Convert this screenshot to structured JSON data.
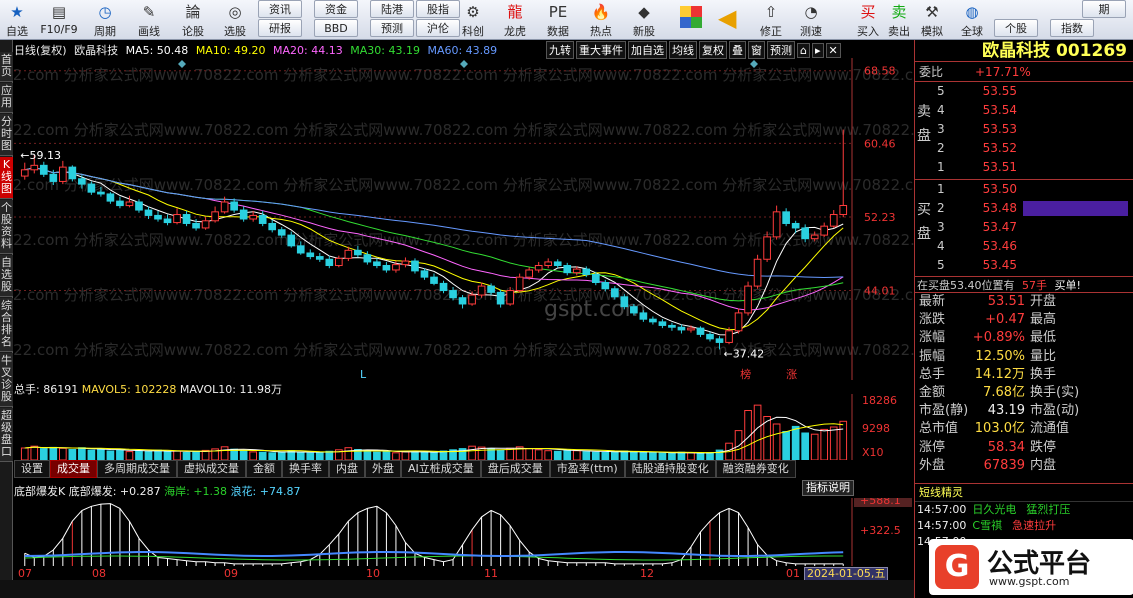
{
  "toolbar": {
    "buttons": [
      {
        "label": "自选",
        "icon": "star-icon"
      },
      {
        "label": "F10/F9",
        "icon": "document-icon"
      },
      {
        "label": "周期",
        "icon": "clock-icon"
      },
      {
        "label": "画线",
        "icon": "pencil-icon"
      },
      {
        "label": "论股",
        "icon": "discuss-icon"
      },
      {
        "label": "选股",
        "icon": "chart-search-icon"
      },
      {
        "label": "科创",
        "icon": "tech-icon"
      },
      {
        "label": "龙虎",
        "icon": "dragon-icon"
      },
      {
        "label": "数据",
        "icon": "pe-data-icon"
      },
      {
        "label": "热点",
        "icon": "hot-icon"
      },
      {
        "label": "新股",
        "icon": "ipo-icon"
      },
      {
        "label": "修正",
        "icon": "arrow-up-icon"
      },
      {
        "label": "测速",
        "icon": "speedometer-icon"
      },
      {
        "label": "买入",
        "icon": "buy-icon"
      },
      {
        "label": "卖出",
        "icon": "sell-icon"
      },
      {
        "label": "模拟",
        "icon": "hammer-icon"
      },
      {
        "label": "全球",
        "icon": "globe-icon"
      }
    ],
    "small_buttons_top": [
      "资讯",
      "资金",
      "陆港",
      "股指",
      "期"
    ],
    "small_buttons_bottom": [
      "研报",
      "BBD",
      "预测",
      "沪伦",
      "个股",
      "指数"
    ],
    "brand_stamps": [
      "PE",
      "HOT"
    ]
  },
  "left_tabs": [
    "首页",
    "应用",
    "分时图",
    "K线图",
    "个股资料",
    "自选股",
    "综合排名",
    "牛叉诊股",
    "超级盘口"
  ],
  "chart_header": {
    "mode": "日线(复权)",
    "stock": "欧晶科技",
    "ma5": "MA5: 50.48",
    "ma10": "MA10: 49.20",
    "ma20": "MA20: 44.13",
    "ma30": "MA30: 43.19",
    "ma60": "MA60: 43.89",
    "buttons": [
      "九转",
      "重大事件",
      "加自选",
      "均线",
      "复权",
      "叠",
      "窗",
      "预测"
    ]
  },
  "watermark": "0822.com 分析家公式网www.70822.com 分析家公式网www.70822.com 分析家公式网www.70822.com 分析家公式网www.70822.com 分析家公式网www.7",
  "watermark_site": "gspt.com",
  "chart_data": [
    {
      "type": "candlestick",
      "title": "欧晶科技 日线(复权)",
      "y_axis_ticks": [
        "68.58",
        "60.46",
        "52.23",
        "44.01"
      ],
      "ylim": [
        34,
        70
      ],
      "annotations": [
        "59.13",
        "37.42",
        "榜",
        "涨",
        "L"
      ],
      "x_month_labels": [
        "07",
        "08",
        "09",
        "10",
        "11",
        "12",
        "01"
      ],
      "closes": [
        57.5,
        58.0,
        57.0,
        56.2,
        57.8,
        56.5,
        55.9,
        55.0,
        54.8,
        54.0,
        53.5,
        53.9,
        53.0,
        52.4,
        52.0,
        51.6,
        52.5,
        51.5,
        51.0,
        51.8,
        52.8,
        53.9,
        53.0,
        52.0,
        52.4,
        51.5,
        50.8,
        50.2,
        49.0,
        48.2,
        47.8,
        47.5,
        46.8,
        47.6,
        48.5,
        48.0,
        47.2,
        46.8,
        46.3,
        46.9,
        47.3,
        46.2,
        45.5,
        44.8,
        44.0,
        43.2,
        42.5,
        43.5,
        44.5,
        43.8,
        42.5,
        44.0,
        45.5,
        46.3,
        46.8,
        47.2,
        46.8,
        46.0,
        46.4,
        45.8,
        44.9,
        44.2,
        43.3,
        42.2,
        41.5,
        40.8,
        40.5,
        40.1,
        39.9,
        39.6,
        39.8,
        39.1,
        38.6,
        38.2,
        39.5,
        41.5,
        44.5,
        47.5,
        50.0,
        52.8,
        51.5,
        51.0,
        49.8,
        50.2,
        51.2,
        52.5,
        53.51
      ],
      "opens": [
        56.8,
        57.5,
        58.0,
        57.0,
        56.2,
        57.8,
        56.5,
        55.9,
        55.0,
        54.8,
        54.0,
        53.5,
        53.9,
        53.0,
        52.4,
        52.0,
        51.6,
        52.5,
        51.5,
        51.0,
        51.8,
        52.8,
        53.9,
        53.0,
        52.0,
        52.4,
        51.5,
        50.8,
        50.2,
        49.0,
        48.2,
        47.8,
        47.5,
        46.8,
        47.6,
        48.5,
        48.0,
        47.2,
        46.8,
        46.3,
        46.9,
        47.3,
        46.2,
        45.5,
        44.8,
        44.0,
        43.2,
        42.5,
        43.5,
        44.5,
        43.8,
        42.5,
        44.0,
        45.5,
        46.3,
        46.8,
        47.2,
        46.8,
        46.0,
        46.4,
        45.8,
        44.9,
        44.2,
        43.3,
        42.2,
        41.5,
        40.8,
        40.5,
        40.1,
        39.9,
        39.6,
        39.8,
        39.1,
        38.6,
        38.2,
        39.5,
        41.5,
        44.5,
        47.5,
        50.0,
        52.8,
        51.5,
        51.0,
        49.8,
        50.2,
        51.2,
        52.5
      ],
      "highs": [
        58.3,
        59.13,
        58.4,
        57.5,
        58.5,
        58.0,
        56.9,
        56.2,
        55.6,
        55.0,
        54.5,
        54.6,
        54.2,
        53.4,
        52.9,
        52.5,
        53.2,
        52.9,
        52.0,
        52.2,
        53.4,
        54.5,
        54.3,
        53.4,
        52.9,
        52.9,
        51.9,
        51.1,
        50.6,
        49.5,
        48.6,
        48.2,
        47.9,
        47.9,
        48.9,
        49.0,
        48.4,
        47.6,
        47.2,
        47.3,
        47.7,
        47.6,
        46.5,
        45.9,
        45.1,
        44.4,
        43.5,
        43.9,
        44.9,
        44.8,
        44.1,
        44.4,
        45.9,
        46.6,
        47.2,
        47.6,
        47.5,
        47.1,
        46.7,
        46.7,
        46.1,
        45.2,
        44.5,
        43.6,
        42.5,
        41.8,
        41.1,
        40.8,
        40.4,
        40.2,
        40.1,
        40.0,
        39.4,
        38.9,
        39.9,
        42.0,
        45.0,
        48.0,
        50.6,
        53.5,
        53.2,
        51.8,
        51.4,
        50.6,
        51.6,
        53.0,
        62.0
      ],
      "lows": [
        56.4,
        57.1,
        56.7,
        55.8,
        55.9,
        56.2,
        55.4,
        54.7,
        54.5,
        53.7,
        53.2,
        53.3,
        52.7,
        52.0,
        51.7,
        51.3,
        51.4,
        51.2,
        50.7,
        50.8,
        51.6,
        52.6,
        52.7,
        51.7,
        51.7,
        51.2,
        50.5,
        49.9,
        48.8,
        48.0,
        47.5,
        47.2,
        46.5,
        46.6,
        47.3,
        47.7,
        46.9,
        46.5,
        46.0,
        46.0,
        46.6,
        45.9,
        45.2,
        44.6,
        43.7,
        42.9,
        42.0,
        42.3,
        43.2,
        43.5,
        42.1,
        42.3,
        43.8,
        45.2,
        46.0,
        46.5,
        46.5,
        45.7,
        45.7,
        45.5,
        44.6,
        43.9,
        43.0,
        41.9,
        41.2,
        40.5,
        40.2,
        39.8,
        39.5,
        39.2,
        39.3,
        38.8,
        38.3,
        37.42,
        38.0,
        39.2,
        41.2,
        44.2,
        47.2,
        49.7,
        51.2,
        50.4,
        49.4,
        49.5,
        50.0,
        51.0,
        52.2
      ]
    },
    {
      "type": "bar",
      "title": "总手",
      "y_axis_ticks": [
        "18286",
        "9298",
        "X10"
      ],
      "ylim": [
        0,
        20000
      ],
      "values": [
        4000,
        4600,
        3800,
        4200,
        3900,
        3500,
        4100,
        3300,
        3600,
        3000,
        3400,
        2800,
        3100,
        2900,
        3300,
        2700,
        3000,
        2500,
        2800,
        3200,
        3700,
        4400,
        3600,
        3000,
        2700,
        2600,
        2400,
        2700,
        3100,
        2600,
        2300,
        2500,
        2900,
        3400,
        4100,
        3500,
        3000,
        2600,
        2800,
        2400,
        2700,
        3000,
        2600,
        2500,
        3000,
        3400,
        3800,
        4600,
        4300,
        3700,
        3200,
        3900,
        4400,
        3800,
        3400,
        3100,
        2900,
        3300,
        3100,
        2800,
        2600,
        2500,
        2800,
        3000,
        2700,
        2500,
        2400,
        2300,
        2200,
        2600,
        2400,
        2200,
        2500,
        3300,
        5600,
        9800,
        16500,
        18286,
        14500,
        12000,
        9500,
        11200,
        9000,
        8600,
        10200,
        11000,
        12900
      ]
    },
    {
      "type": "bar",
      "title": "底部爆发K 底部爆发",
      "y_axis_ticks": [
        "+588.1",
        "+322.5"
      ],
      "values": [
        120,
        80,
        90,
        150,
        260,
        420,
        520,
        560,
        580,
        585,
        540,
        420,
        260,
        150,
        80,
        70,
        60,
        50,
        40,
        40,
        30,
        30,
        20,
        20,
        20,
        20,
        20,
        20,
        30,
        40,
        60,
        110,
        200,
        300,
        420,
        500,
        540,
        560,
        500,
        380,
        220,
        120,
        80,
        60,
        40,
        60,
        200,
        340,
        460,
        520,
        480,
        380,
        240,
        130,
        70,
        50,
        40,
        30,
        30,
        30,
        30,
        30,
        20,
        20,
        20,
        20,
        20,
        20,
        30,
        60,
        180,
        320,
        420,
        500,
        540,
        500,
        360,
        200,
        100,
        50,
        30,
        20,
        20,
        20,
        20,
        20,
        20
      ]
    }
  ],
  "volume_header": {
    "total": "总手: 86191",
    "mavol5": "MAVOL5: 102228",
    "mavol10": "MAVOL10: 11.98万"
  },
  "volume_tabs": [
    "设置",
    "成交量",
    "多周期成交量",
    "虚拟成交量",
    "金额",
    "换手率",
    "内盘",
    "外盘",
    "AI立桩成交量",
    "盘后成交量",
    "市盈率(ttm)",
    "陆股通持股变化",
    "融资融券变化"
  ],
  "indicator_header": {
    "name": "底部爆发K 底部爆发:",
    "v1": "+0.287",
    "v2": "海岸: +1.38",
    "v3": "浪花: +74.87"
  },
  "indicator_button": "指标说明",
  "date_badge": "2024-01-05,五",
  "right_panel": {
    "stock_title": "欧晶科技 001269",
    "commission_label": "委比",
    "commission_value": "+17.71%",
    "sell_side_label": "卖盘",
    "buy_side_label": "买盘",
    "sell_levels": [
      {
        "level": "5",
        "price": "53.55"
      },
      {
        "level": "4",
        "price": "53.54"
      },
      {
        "level": "3",
        "price": "53.53"
      },
      {
        "level": "2",
        "price": "53.52"
      },
      {
        "level": "1",
        "price": "53.51"
      }
    ],
    "buy_levels": [
      {
        "level": "1",
        "price": "53.50"
      },
      {
        "level": "2",
        "price": "53.48"
      },
      {
        "level": "3",
        "price": "53.47"
      },
      {
        "level": "4",
        "price": "53.46"
      },
      {
        "level": "5",
        "price": "53.45"
      }
    ],
    "mid_note": "在买盘53.40位置有",
    "mid_note_qty": "57手",
    "mid_note_action": "买单!",
    "quotes": [
      {
        "l1": "最新",
        "v1": "53.51",
        "l2": "开盘"
      },
      {
        "l1": "涨跌",
        "v1": "+0.47",
        "l2": "最高"
      },
      {
        "l1": "涨幅",
        "v1": "+0.89%",
        "l2": "最低"
      },
      {
        "l1": "振幅",
        "v1": "12.50%",
        "l2": "量比"
      },
      {
        "l1": "总手",
        "v1": "14.12万",
        "l2": "换手"
      },
      {
        "l1": "金额",
        "v1": "7.68亿",
        "l2": "换手(实)"
      },
      {
        "l1": "市盈(静)",
        "v1": "43.19",
        "l2": "市盈(动)"
      },
      {
        "l1": "总市值",
        "v1": "103.0亿",
        "l2": "流通值"
      },
      {
        "l1": "涨停",
        "v1": "58.34",
        "l2": "跌停"
      },
      {
        "l1": "外盘",
        "v1": "67839",
        "l2": "内盘"
      }
    ],
    "alerts_title": "短线精灵",
    "alerts": [
      {
        "time": "14:57:00",
        "name": "日久光电",
        "event": "猛烈打压"
      },
      {
        "time": "14:57:00",
        "name": "C雪祺",
        "event": "急速拉升"
      },
      {
        "time": "14:57:00",
        "name": "",
        "event": ""
      }
    ],
    "brand_name": "公式平台",
    "brand_url": "www.gspt.com",
    "brand_logo": "G"
  },
  "colors": {
    "up": "#ff3c3c",
    "down": "#2ad0e0",
    "ma5": "#ffffff",
    "ma10": "#ffff00",
    "ma20": "#ff66ff",
    "ma30": "#33dd33",
    "ma60": "#6699ff"
  }
}
